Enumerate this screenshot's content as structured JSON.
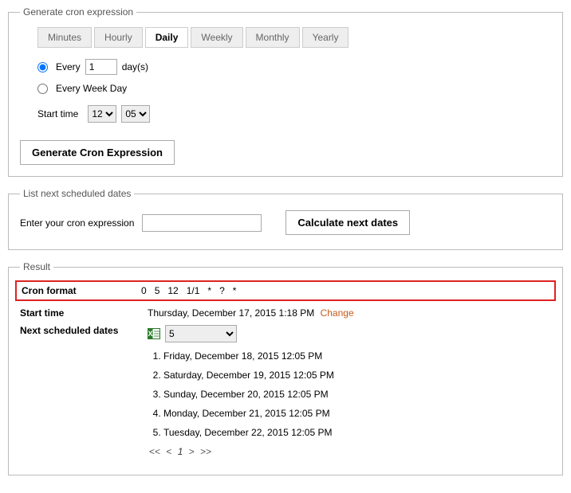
{
  "generate": {
    "legend": "Generate cron expression",
    "tabs": [
      "Minutes",
      "Hourly",
      "Daily",
      "Weekly",
      "Monthly",
      "Yearly"
    ],
    "active_tab": "Daily",
    "every_label_prefix": "Every",
    "every_days_value": "1",
    "every_label_suffix": "day(s)",
    "weekday_label": "Every Week Day",
    "start_time_label": "Start time",
    "hour_value": "12",
    "minute_value": "05",
    "generate_button": "Generate Cron Expression"
  },
  "list": {
    "legend": "List next scheduled dates",
    "enter_label": "Enter your cron expression",
    "input_value": "",
    "calc_button": "Calculate next dates"
  },
  "result": {
    "legend": "Result",
    "cron_format_label": "Cron format",
    "cron_parts": [
      "0",
      "5",
      "12",
      "1/1",
      "*",
      "?",
      "*"
    ],
    "start_time_label": "Start time",
    "start_time_value": "Thursday, December 17, 2015 1:18 PM",
    "change_label": "Change",
    "next_dates_label": "Next scheduled dates",
    "count_value": "5",
    "dates": [
      "Friday, December 18, 2015 12:05 PM",
      "Saturday, December 19, 2015 12:05 PM",
      "Sunday, December 20, 2015 12:05 PM",
      "Monday, December 21, 2015 12:05 PM",
      "Tuesday, December 22, 2015 12:05 PM"
    ],
    "pager": {
      "first": "<<",
      "prev": "<",
      "current": "1",
      "next": ">",
      "last": ">>"
    }
  }
}
